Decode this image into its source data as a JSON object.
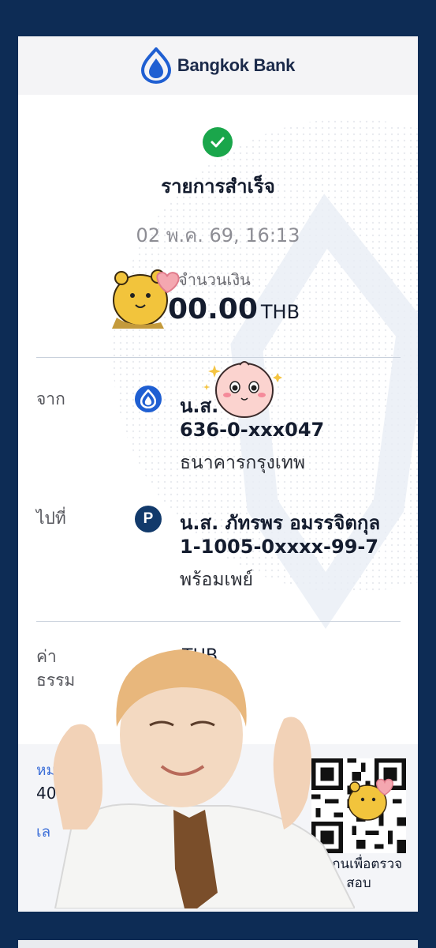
{
  "header": {
    "brand": "Bangkok Bank"
  },
  "receipt": {
    "status": "รายการสำเร็จ",
    "datetime": "02 พ.ค. 69, 16:13",
    "amount_label": "จำนวนเงิน",
    "amount_value": "00.00",
    "currency": "THB"
  },
  "from": {
    "label": "จาก",
    "name": "น.ส.",
    "account": "636-0-xxx047",
    "bank": "ธนาคารกรุงเทพ",
    "icon": "bangkok-bank-logo-icon"
  },
  "to": {
    "label": "ไปที่",
    "name": "น.ส. ภัทรพร อมรรจิตกุล",
    "account": "1-1005-0xxxx-99-7",
    "bank": "พร้อมเพย์",
    "icon_text": "P"
  },
  "fee": {
    "label_line1": "ค่า",
    "label_line2": "ธรรม",
    "value": "THB"
  },
  "reference": {
    "label1": "หมา",
    "value1": "401",
    "label2": "เล",
    "qr_caption_line1": "สแกนเพื่อตรวจ",
    "qr_caption_line2": "สอบ"
  },
  "colors": {
    "page_background": "#0d2c55",
    "success": "#1aa64b",
    "brand_blue": "#1f5fd2",
    "promptpay_badge": "#123a6b",
    "reference_label": "#3d6fd8"
  },
  "overlays": [
    "bear-sticker",
    "peach-sticker",
    "person-photo-sticker",
    "bear-sticker-small"
  ]
}
